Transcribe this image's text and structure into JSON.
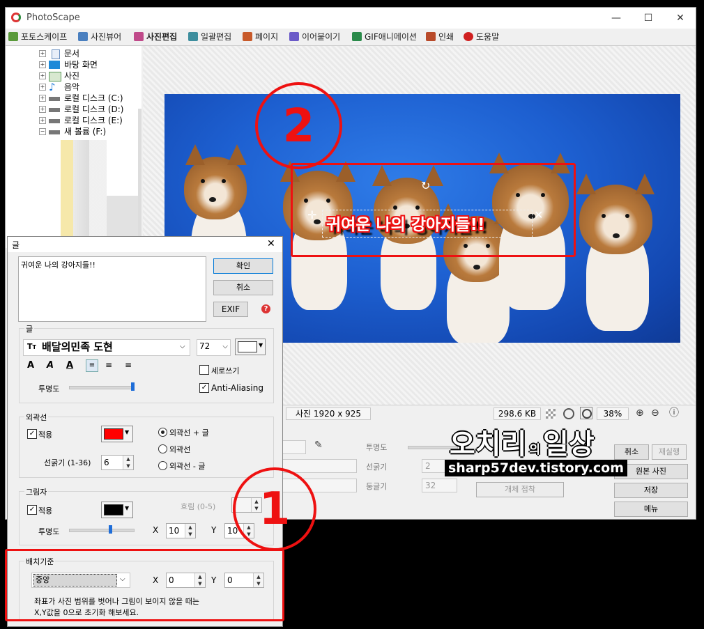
{
  "window": {
    "title": "PhotoScape",
    "minimize": "—",
    "maximize": "☐",
    "close": "✕"
  },
  "tabs": [
    {
      "label": "포토스케이프",
      "color": "#5a9a3a"
    },
    {
      "label": "사진뷰어",
      "color": "#4a7fbf"
    },
    {
      "label": "사진편집",
      "color": "#c04a8a"
    },
    {
      "label": "일괄편집",
      "color": "#3e8e9e"
    },
    {
      "label": "페이지",
      "color": "#c85a2a"
    },
    {
      "label": "이어붙이기",
      "color": "#6a5ac8"
    },
    {
      "label": "GIF애니메이션",
      "color": "#2a8a4a"
    },
    {
      "label": "인쇄",
      "color": "#b84a2a"
    },
    {
      "label": "도움말",
      "color": "#d02020"
    }
  ],
  "tree": [
    {
      "label": "문서",
      "color": "#6a8fbf"
    },
    {
      "label": "바탕 화면",
      "color": "#1e8ad8"
    },
    {
      "label": "사진",
      "color": "#5a9a5a"
    },
    {
      "label": "음악",
      "color": "#1e7ad8"
    },
    {
      "label": "로컬 디스크 (C:)",
      "color": "#555"
    },
    {
      "label": "로컬 디스크 (D:)",
      "color": "#555"
    },
    {
      "label": "로컬 디스크 (E:)",
      "color": "#555"
    },
    {
      "label": "새 볼륨 (F:)",
      "color": "#555"
    }
  ],
  "photo_text": "귀여운 나의 강아지들!!",
  "status": {
    "size": "사진 1920 x 925",
    "filesize": "298.6 KB",
    "zoom": "38%"
  },
  "bottom": {
    "opacity_label": "투명도",
    "line_label": "선굵기",
    "line_value": "2",
    "round_label": "둥글기",
    "round_value": "32",
    "attach_button": "개체 접착",
    "cancel_button": "취소",
    "redo_button": "재실행",
    "original_button": "원본 사진",
    "save_button": "저장",
    "menu_button": "메뉴"
  },
  "watermark": {
    "title": "오치리",
    "particle": "의",
    "title2": "일상",
    "url": "sharp57dev.tistory.com"
  },
  "dialog": {
    "title": "글",
    "close": "✕",
    "text_value": "귀여운 나의 강아지들!!",
    "ok_button": "확인",
    "cancel_button": "취소",
    "exif_button": "EXIF",
    "help_icon": "?",
    "font_group": "글",
    "font_name": "배달의민족 도현",
    "font_size": "72",
    "text_color": "#ffffff",
    "vertical_label": "세로쓰기",
    "antialias_label": "Anti-Aliasing",
    "opacity_label": "투명도",
    "opacity_value": 0.95,
    "outline_group": "외곽선",
    "outline_apply": "적용",
    "outline_color": "#ff0000",
    "outline_opt1": "외곽선 + 글",
    "outline_opt2": "외곽선",
    "outline_opt3": "외곽선 - 글",
    "outline_width_label": "선굵기 (1-36)",
    "outline_width": "6",
    "shadow_group": "그림자",
    "shadow_apply": "적용",
    "shadow_color": "#000000",
    "blur_label": "흐림 (0-5)",
    "blur_value": "",
    "shadow_opacity_label": "투명도",
    "shadow_opacity_value": 0.6,
    "x_label": "X",
    "x_value": "10",
    "y_label": "Y",
    "y_value": "10",
    "position_group": "배치기준",
    "position_value": "중앙",
    "pos_x_value": "0",
    "pos_y_value": "0",
    "note_line1": "좌표가 사진 범위를 벗어나 그림이 보이지 않을 때는",
    "note_line2": "X,Y값을 0으로 초기화 해보세요."
  },
  "annotations": {
    "step1": "1",
    "step2": "2",
    "color": "#ee1111"
  }
}
